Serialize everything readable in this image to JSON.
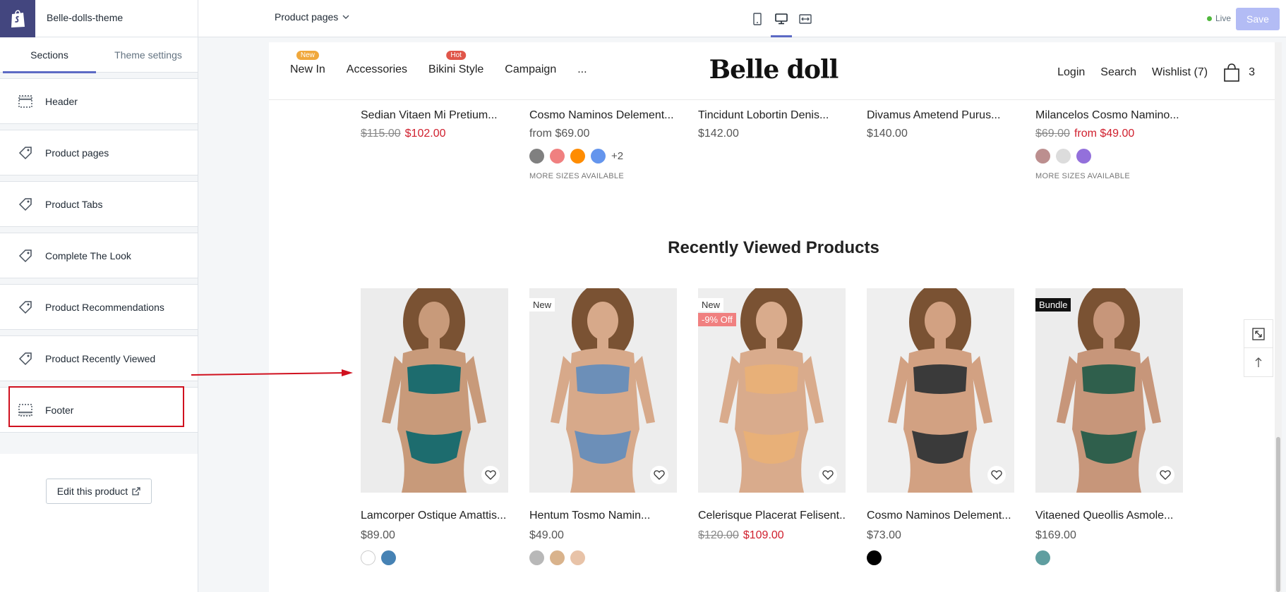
{
  "app": {
    "theme_name": "Belle-dolls-theme"
  },
  "toolbar": {
    "page_select": "Product pages",
    "live_label": "Live",
    "save_label": "Save"
  },
  "sidebar": {
    "tabs": [
      {
        "label": "Sections"
      },
      {
        "label": "Theme settings"
      }
    ],
    "sections": [
      {
        "label": "Header",
        "icon": "header-icon"
      },
      {
        "label": "Product pages",
        "icon": "tag-icon"
      },
      {
        "label": "Product Tabs",
        "icon": "tag-icon"
      },
      {
        "label": "Complete The Look",
        "icon": "tag-icon"
      },
      {
        "label": "Product Recommendations",
        "icon": "tag-icon"
      },
      {
        "label": "Product Recently Viewed",
        "icon": "tag-icon"
      },
      {
        "label": "Footer",
        "icon": "footer-icon"
      }
    ],
    "edit_button": "Edit this product"
  },
  "store": {
    "brand": "Belle doll",
    "nav": [
      {
        "label": "New In",
        "badge": "New",
        "badge_color": "#f0a83c"
      },
      {
        "label": "Accessories",
        "badge": ""
      },
      {
        "label": "Bikini Style",
        "badge": "Hot",
        "badge_color": "#e0564a"
      },
      {
        "label": "Campaign",
        "badge": ""
      },
      {
        "label": "...",
        "badge": ""
      }
    ],
    "nav_right": {
      "login": "Login",
      "search": "Search",
      "wishlist": "Wishlist (7)",
      "cart_count": "3"
    },
    "upper_products": [
      {
        "name": "Sedian Vitaen Mi Pretium...",
        "old_price": "$115.00",
        "price": "$102.00",
        "swatches": [],
        "more": "",
        "extra": ""
      },
      {
        "name": "Cosmo Naminos Delement...",
        "old_price": "",
        "price": "from $69.00",
        "swatches": [
          "#808080",
          "#f08080",
          "#ff8c00",
          "#6495ed"
        ],
        "extra": "+2",
        "more": "MORE SIZES AVAILABLE"
      },
      {
        "name": "Tincidunt Lobortin Denis...",
        "old_price": "",
        "price": "$142.00",
        "swatches": [],
        "more": "",
        "extra": ""
      },
      {
        "name": "Divamus Ametend Purus...",
        "old_price": "",
        "price": "$140.00",
        "swatches": [],
        "more": "",
        "extra": ""
      },
      {
        "name": "Milancelos Cosmo Namino...",
        "old_price": "$69.00",
        "price": "from $49.00",
        "swatches": [
          "#bc8f8f",
          "#dcdcdc",
          "#9370db"
        ],
        "extra": "",
        "more": "MORE SIZES AVAILABLE"
      }
    ],
    "recently_viewed_title": "Recently Viewed Products",
    "recent_products": [
      {
        "name": "Lamcorper Ostique Amattis...",
        "old_price": "",
        "price": "$89.00",
        "labels": [],
        "swatches": [
          "#ffffff",
          "#4682b4"
        ],
        "skin": "#c89a7a",
        "suit": "#1d6c6e",
        "bg": "#ececec"
      },
      {
        "name": "Hentum Tosmo Namin...",
        "old_price": "",
        "price": "$49.00",
        "labels": [
          {
            "text": "New",
            "bg": "#ffffff",
            "color": "#333333"
          }
        ],
        "swatches": [
          "#b8b8b8",
          "#d9b38c",
          "#e8c3a8"
        ],
        "skin": "#d7a98a",
        "suit": "#6c8fb8",
        "bg": "#ededed"
      },
      {
        "name": "Celerisque Placerat Felisent...",
        "old_price": "$120.00",
        "price": "$109.00",
        "labels": [
          {
            "text": "New",
            "bg": "#ffffff",
            "color": "#333333"
          },
          {
            "text": "-9% Off",
            "bg": "#f08080",
            "color": "#ffffff"
          }
        ],
        "swatches": [],
        "skin": "#d9ab8c",
        "suit": "#e8b078",
        "bg": "#eeeeee"
      },
      {
        "name": "Cosmo Naminos Delement...",
        "old_price": "",
        "price": "$73.00",
        "labels": [],
        "swatches": [
          "#000000"
        ],
        "skin": "#d2a182",
        "suit": "#3a3a3a",
        "bg": "#efefef"
      },
      {
        "name": "Vitaened Queollis Asmole...",
        "old_price": "",
        "price": "$169.00",
        "labels": [
          {
            "text": "Bundle",
            "bg": "#111111",
            "color": "#ffffff"
          }
        ],
        "swatches": [
          "#5f9ea0"
        ],
        "skin": "#c7967a",
        "suit": "#2f5f4c",
        "bg": "#ececec"
      }
    ]
  },
  "colors": {
    "accent": "#5c6ac4",
    "sale": "#d0202e",
    "highlight": "#d0111f"
  }
}
